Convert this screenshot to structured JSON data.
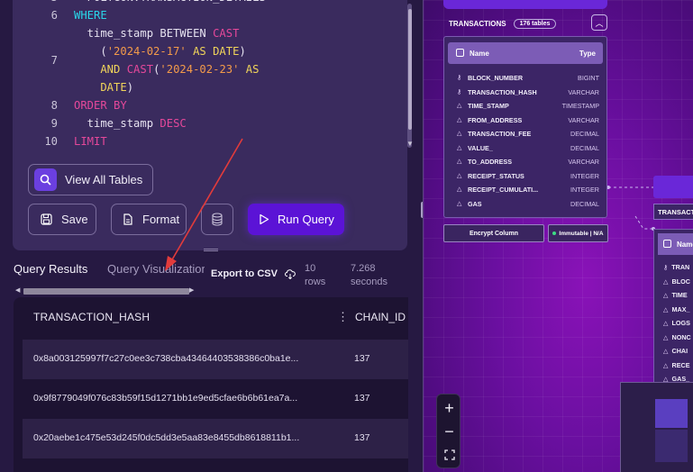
{
  "editor": {
    "lines": [
      {
        "num": "5",
        "parts": [
          {
            "c": "id",
            "t": "  POLYGON.TRANSACTION_DETAILS"
          }
        ]
      },
      {
        "num": "6",
        "parts": [
          {
            "c": "kw",
            "t": "WHERE"
          }
        ]
      },
      {
        "num": "",
        "parts": [
          {
            "c": "id",
            "t": "  time_stamp BETWEEN "
          },
          {
            "c": "fn",
            "t": "CAST"
          }
        ]
      },
      {
        "num": "7",
        "parts": [
          {
            "c": "pl",
            "t": "    ("
          },
          {
            "c": "str",
            "t": "'2024-02-17'"
          },
          {
            "c": "kw2",
            "t": " AS DATE"
          },
          {
            "c": "pl",
            "t": ")"
          }
        ]
      },
      {
        "num": "",
        "parts": [
          {
            "c": "kw2",
            "t": "    AND "
          },
          {
            "c": "fn",
            "t": "CAST"
          },
          {
            "c": "pl",
            "t": "("
          },
          {
            "c": "str",
            "t": "'2024-02-23'"
          },
          {
            "c": "kw2",
            "t": " AS"
          }
        ]
      },
      {
        "num": "",
        "parts": [
          {
            "c": "kw2",
            "t": "    DATE"
          },
          {
            "c": "pl",
            "t": ")"
          }
        ]
      },
      {
        "num": "8",
        "parts": [
          {
            "c": "fn",
            "t": "ORDER BY"
          }
        ]
      },
      {
        "num": "9",
        "parts": [
          {
            "c": "id",
            "t": "  time_stamp "
          },
          {
            "c": "fn",
            "t": "DESC"
          }
        ]
      },
      {
        "num": "10",
        "parts": [
          {
            "c": "fn",
            "t": "LIMIT"
          }
        ]
      }
    ]
  },
  "buttons": {
    "view_all": "View All Tables",
    "save": "Save",
    "format": "Format",
    "run": "Run Query"
  },
  "results": {
    "tab_results": "Query Results",
    "tab_visualization": "Query Visualization",
    "export": "Export to CSV",
    "rows_count": "10",
    "rows_label": "rows",
    "seconds_value": "7.268",
    "seconds_label": "seconds",
    "columns": [
      "TRANSACTION_HASH",
      "CHAIN_ID"
    ],
    "rows": [
      {
        "hash": "0x8a003125997f7c27c0ee3c738cba43464403538386c0ba1e...",
        "chain": "137"
      },
      {
        "hash": "0x9f8779049f076c83b59f15d1271bb1e9ed5cfae6b6b61ea7a...",
        "chain": "137"
      },
      {
        "hash": "0x20aebe1c475e53d245f0dc5dd3e5aa83e8455db8618811b1...",
        "chain": "137"
      }
    ]
  },
  "schema": {
    "node_title": "TRANSACTIONS",
    "table_count": "176 tables",
    "header_name": "Name",
    "header_type": "Type",
    "columns": [
      {
        "key": true,
        "name": "BLOCK_NUMBER",
        "type": "BIGINT"
      },
      {
        "key": true,
        "name": "TRANSACTION_HASH",
        "type": "VARCHAR"
      },
      {
        "key": false,
        "name": "TIME_STAMP",
        "type": "TIMESTAMP"
      },
      {
        "key": false,
        "name": "FROM_ADDRESS",
        "type": "VARCHAR"
      },
      {
        "key": false,
        "name": "TRANSACTION_FEE",
        "type": "DECIMAL"
      },
      {
        "key": false,
        "name": "VALUE_",
        "type": "DECIMAL"
      },
      {
        "key": false,
        "name": "TO_ADDRESS",
        "type": "VARCHAR"
      },
      {
        "key": false,
        "name": "RECEIPT_STATUS",
        "type": "INTEGER"
      },
      {
        "key": false,
        "name": "RECEIPT_CUMULATI...",
        "type": "INTEGER"
      },
      {
        "key": false,
        "name": "GAS",
        "type": "DECIMAL"
      }
    ],
    "encrypt_label": "Encrypt Column",
    "immutable_label": "Immutable | N/A",
    "node2_title": "TRANSACTIONS",
    "node2_header": "Name",
    "node2_columns": [
      {
        "key": true,
        "name": "TRAN"
      },
      {
        "key": false,
        "name": "BLOC"
      },
      {
        "key": false,
        "name": "TIME"
      },
      {
        "key": false,
        "name": "MAX_"
      },
      {
        "key": false,
        "name": "LOGS"
      },
      {
        "key": false,
        "name": "NONC"
      },
      {
        "key": false,
        "name": "CHAI"
      },
      {
        "key": false,
        "name": "RECE"
      },
      {
        "key": false,
        "name": "GAS_"
      }
    ]
  },
  "colors": {
    "accent": "#5b13d6",
    "annotation_arrow": "#e23b3b"
  }
}
